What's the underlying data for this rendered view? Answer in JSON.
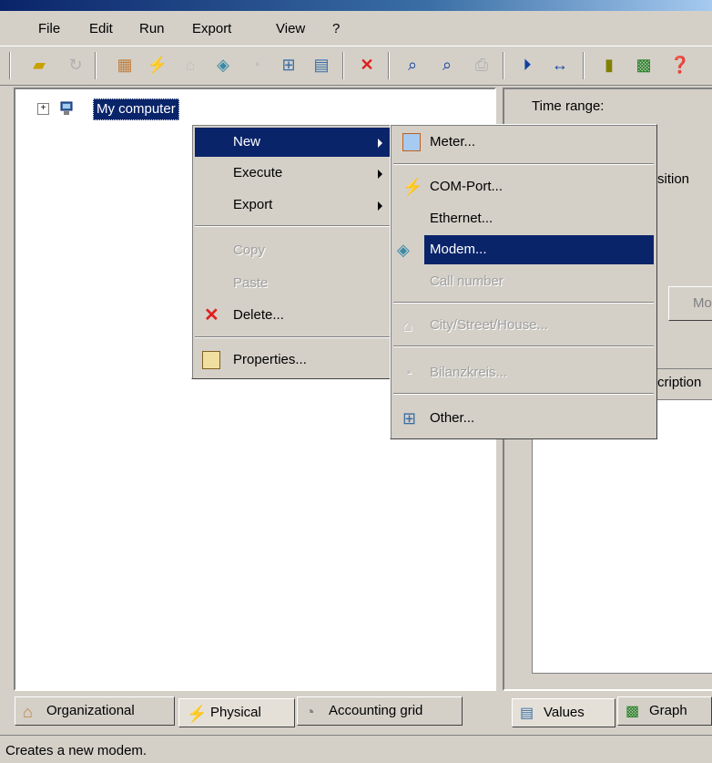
{
  "menubar": {
    "items": [
      "File",
      "Edit",
      "Run",
      "Export",
      "View",
      "?"
    ]
  },
  "tree": {
    "root_label": "My computer",
    "expander": "+"
  },
  "right_panel": {
    "time_range_label": "Time range:",
    "position_fragment": "sition",
    "button_fragment": "Mo",
    "description_fragment": "cription"
  },
  "context_menu": {
    "items": [
      {
        "label": "New",
        "state": "selected",
        "submenu": true
      },
      {
        "label": "Execute",
        "state": "normal",
        "submenu": true
      },
      {
        "label": "Export",
        "state": "normal",
        "submenu": true
      },
      {
        "label": "Copy",
        "state": "disabled"
      },
      {
        "label": "Paste",
        "state": "disabled"
      },
      {
        "label": "Delete...",
        "state": "normal",
        "icon": "delete-x-icon"
      },
      {
        "label": "Properties...",
        "state": "normal",
        "icon": "properties-icon"
      }
    ]
  },
  "submenu": {
    "items": [
      {
        "label": "Meter...",
        "state": "normal",
        "icon": "meter-icon"
      },
      {
        "label": "COM-Port...",
        "state": "normal",
        "icon": "com-port-icon"
      },
      {
        "label": "Ethernet...",
        "state": "normal"
      },
      {
        "label": "Modem...",
        "state": "selected",
        "icon": "modem-icon"
      },
      {
        "label": "Call number",
        "state": "disabled"
      },
      {
        "label": "City/Street/House...",
        "state": "disabled",
        "icon": "house-icon"
      },
      {
        "label": "Bilanzkreis...",
        "state": "disabled",
        "icon": "balance-icon"
      },
      {
        "label": "Other...",
        "state": "normal",
        "icon": "other-tree-icon"
      }
    ]
  },
  "left_tabs": [
    "Organizational",
    "Physical",
    "Accounting grid"
  ],
  "right_tabs": [
    "Values",
    "Graph"
  ],
  "status_text": "Creates a new modem.",
  "colors": {
    "selection": "#0a246a",
    "face": "#d4d0c8",
    "disabled": "#a0a0a0"
  }
}
